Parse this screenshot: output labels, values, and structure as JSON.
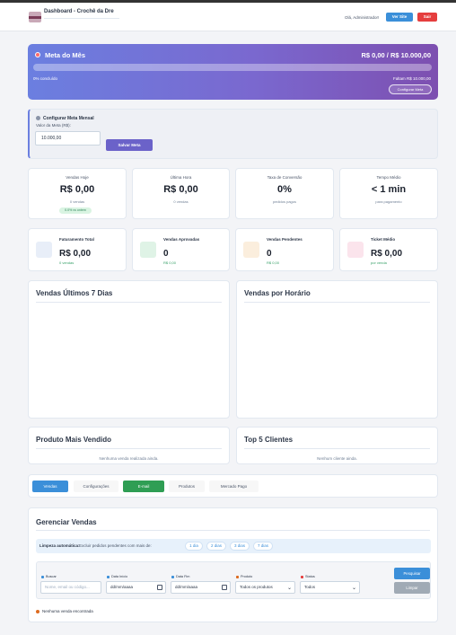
{
  "header": {
    "title": "Dashboard - Crochê da Dre",
    "greeting": "Olá, Administrador!",
    "site_button": "Ver Site",
    "logout_button": "Sair"
  },
  "goal": {
    "title": "Meta do Mês",
    "amount": "R$ 0,00 / R$ 10.000,00",
    "progress_fraction": 0.0,
    "percent_text": "0% concluído",
    "remaining_text": "Faltam R$ 10.000,00",
    "config_button": "Configurar Meta"
  },
  "goal_config": {
    "title": "Configurar Meta Mensal",
    "field_label": "Valor da Meta (R$):",
    "field_value": "10.000,00",
    "save_button": "Salvar Meta"
  },
  "stats": [
    {
      "label": "Vendas Hoje",
      "value": "R$ 0,00",
      "sub": "0 vendas",
      "badge": "0.0% vs ontem"
    },
    {
      "label": "Última Hora",
      "value": "R$ 0,00",
      "sub": "0 vendas",
      "badge": ""
    },
    {
      "label": "Taxa de Conversão",
      "value": "0%",
      "sub": "pedidos pagos",
      "badge": ""
    },
    {
      "label": "Tempo Médio",
      "value": "< 1 min",
      "sub": "para pagamento",
      "badge": ""
    }
  ],
  "kpis": [
    {
      "label": "Faturamento Total",
      "value": "R$ 0,00",
      "sub": "0 vendas",
      "icon": "money-bag-icon",
      "color": "#e8eef8"
    },
    {
      "label": "Vendas Aprovadas",
      "value": "0",
      "sub": "R$ 0,00",
      "icon": "check-icon",
      "color": "#dff3e6"
    },
    {
      "label": "Vendas Pendentes",
      "value": "0",
      "sub": "R$ 0,00",
      "icon": "hourglass-icon",
      "color": "#fbeedd"
    },
    {
      "label": "Ticket Médio",
      "value": "R$ 0,00",
      "sub": "por venda",
      "icon": "bar-chart-icon",
      "color": "#fbe4ec"
    }
  ],
  "panels": {
    "sales_week": "Vendas Últimos 7 Dias",
    "sales_hour": "Vendas por Horário",
    "top_product_title": "Produto Mais Vendido",
    "top_product_empty": "Nenhuma venda realizada ainda.",
    "top_clients_title": "Top 5 Clientes",
    "top_clients_empty": "Nenhum cliente ainda."
  },
  "tabs": [
    "Vendas",
    "Configurações",
    "E-mail",
    "Produtos",
    "Mercado Pago"
  ],
  "manage": {
    "title": "Gerenciar Vendas",
    "cleanup_label": "Limpeza automática:",
    "cleanup_text": "Excluir pedidos pendentes com mais de:",
    "cleanup_days": [
      "1 dia",
      "2 dias",
      "3 dias",
      "7 dias"
    ],
    "filters": {
      "search_label": "Buscar",
      "search_placeholder": "Nome, email ou código...",
      "start_label": "Data Início",
      "start_value": "dd/mm/aaaa",
      "end_label": "Data Fim",
      "end_value": "dd/mm/aaaa",
      "product_label": "Produto",
      "product_value": "Todos os produtos",
      "status_label": "Status",
      "status_value": "Todos",
      "search_button": "Pesquisar",
      "clear_button": "Limpar"
    },
    "empty_text": "Nenhuma venda encontrada"
  },
  "colors": {
    "primary": "#3b8fd9",
    "danger": "#e53e3e",
    "success": "#2f9e54",
    "goal_gradient_start": "#6b7fe0",
    "goal_gradient_end": "#7d4fb0"
  }
}
